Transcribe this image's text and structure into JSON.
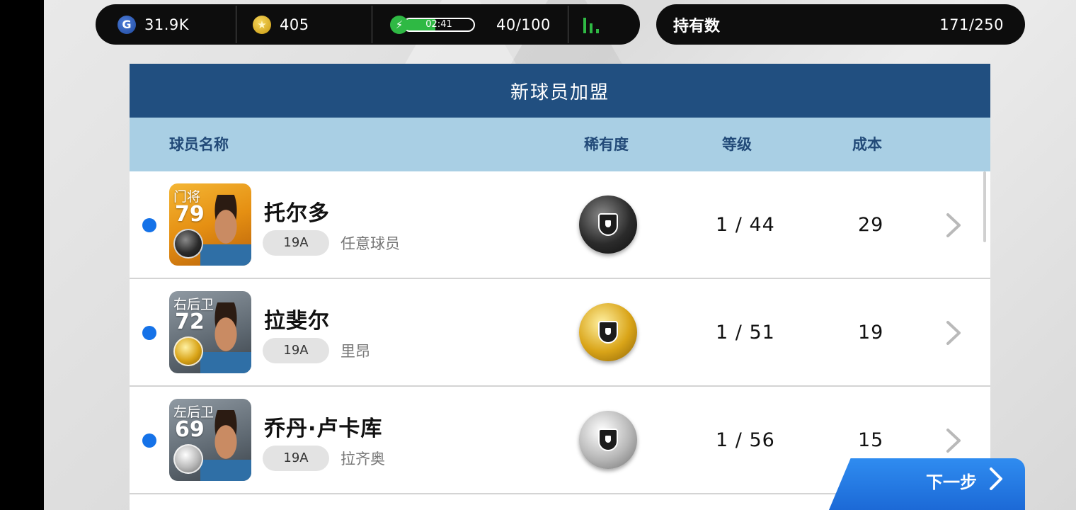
{
  "status": {
    "gp": "31.9K",
    "gp_icon_letter": "G",
    "coins": "405",
    "energy_time": "02:41",
    "energy_fill_fraction": 0.45,
    "energy_count": "40/100"
  },
  "holdings": {
    "label": "持有数",
    "value": "171/250"
  },
  "panel": {
    "title": "新球员加盟",
    "columns": {
      "name": "球员名称",
      "rarity": "稀有度",
      "level": "等级",
      "cost": "成本"
    }
  },
  "players": [
    {
      "position": "门将",
      "rating": "79",
      "name": "托尔多",
      "season": "19A",
      "club": "任意球员",
      "rarity": "black",
      "level": "1 / 44",
      "cost": "29",
      "card_style": "gold"
    },
    {
      "position": "右后卫",
      "rating": "72",
      "name": "拉斐尔",
      "season": "19A",
      "club": "里昂",
      "rarity": "gold",
      "level": "1 / 51",
      "cost": "19",
      "card_style": "grey"
    },
    {
      "position": "左后卫",
      "rating": "69",
      "name": "乔丹·卢卡库",
      "season": "19A",
      "club": "拉齐奥",
      "rarity": "silver",
      "level": "1 / 56",
      "cost": "15",
      "card_style": "grey"
    }
  ],
  "next_button": {
    "label": "下一步"
  },
  "colors": {
    "accent": "#214f80",
    "header": "#a9cfe4",
    "dot": "#1572e8",
    "button": "#1a66d4"
  }
}
